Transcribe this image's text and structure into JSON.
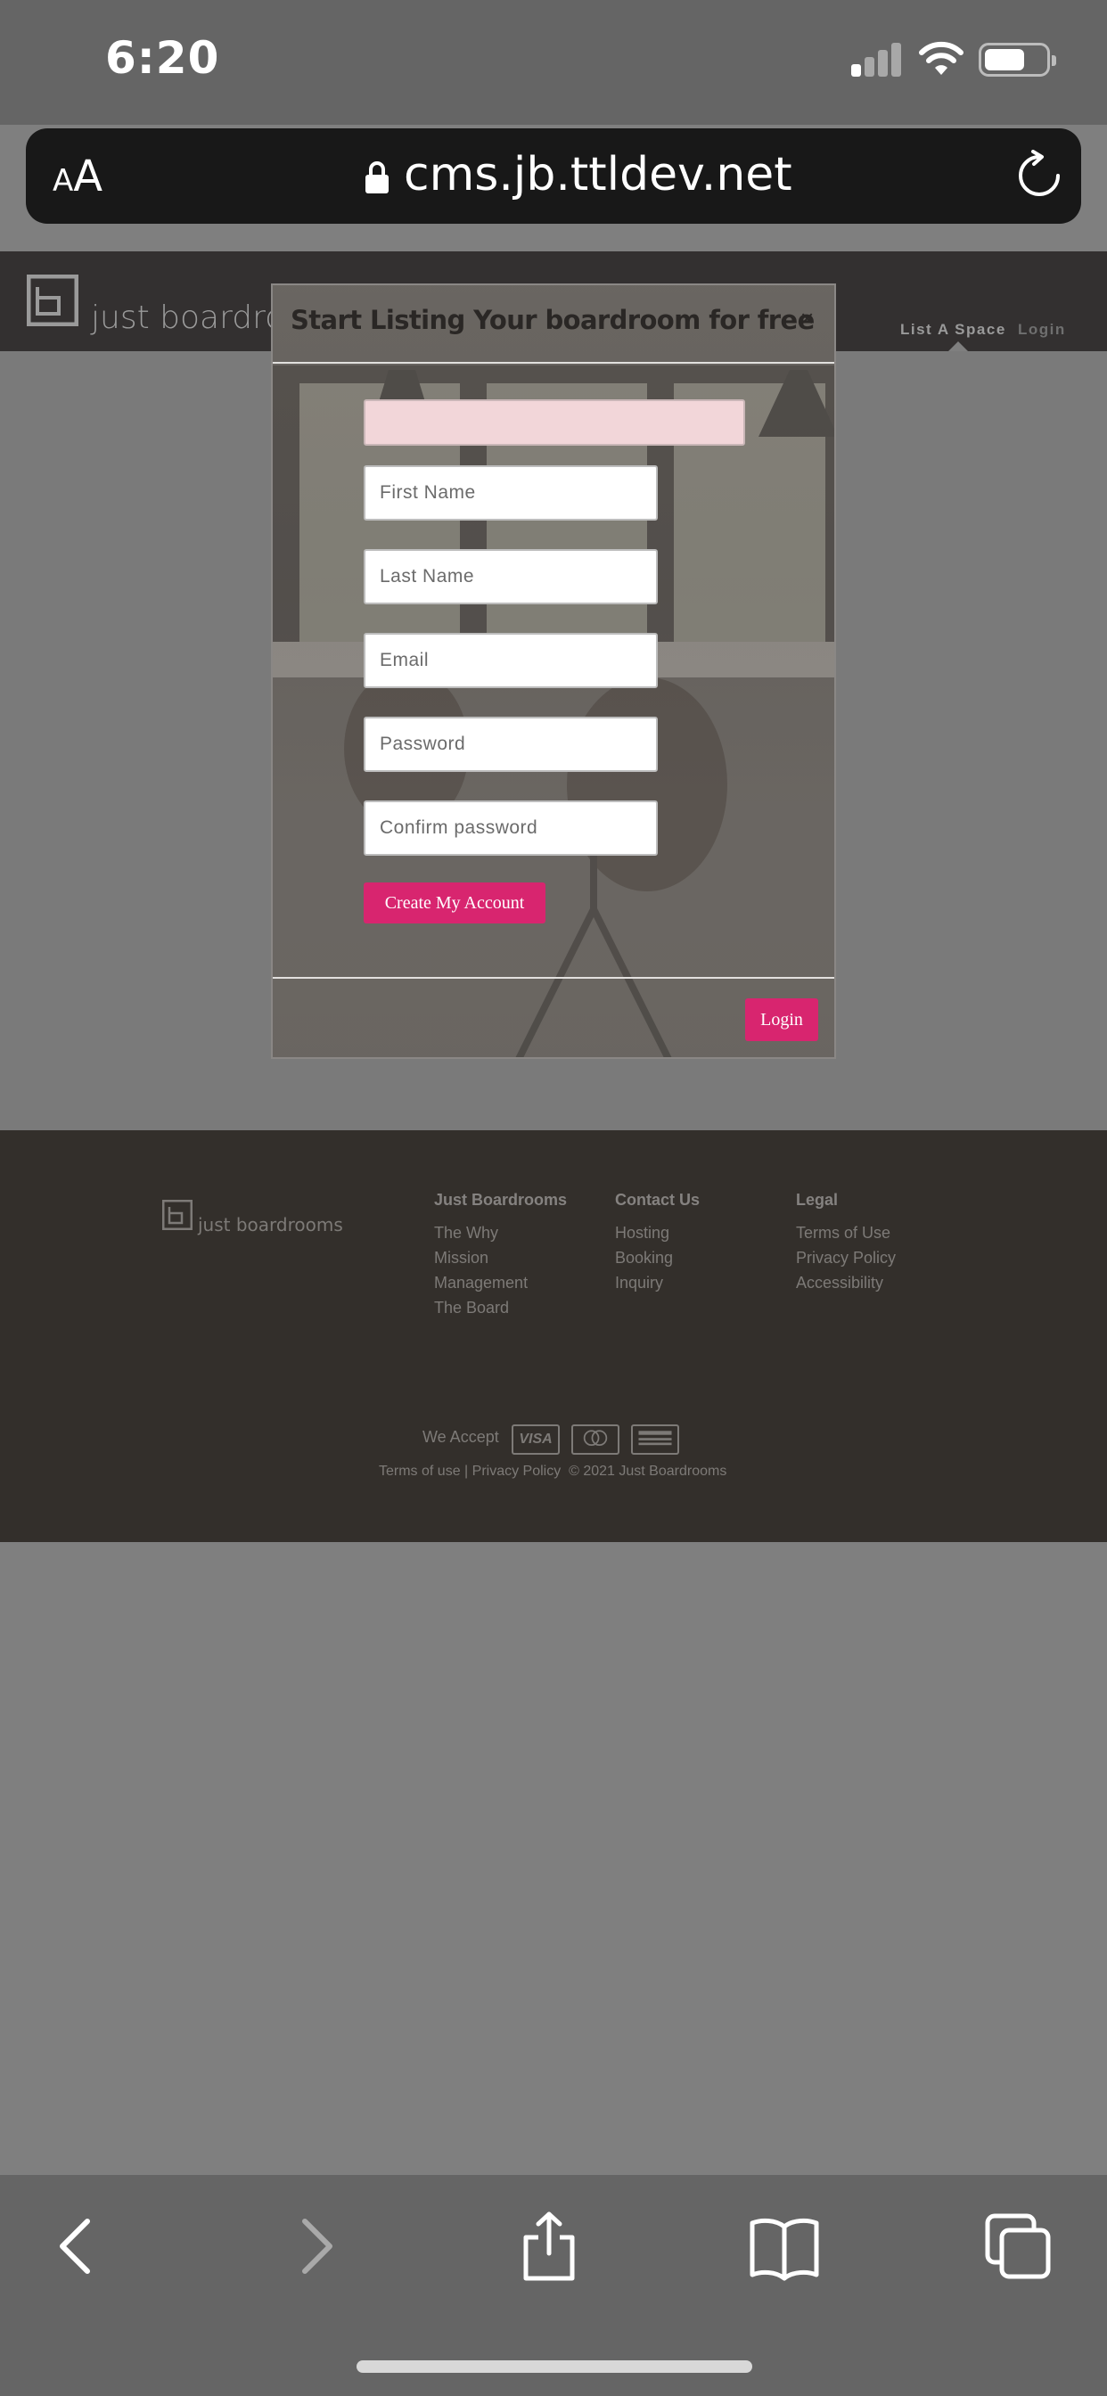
{
  "status_bar": {
    "time": "6:20"
  },
  "browser": {
    "text_size_label_small": "A",
    "text_size_label_big": "A",
    "url": "cms.jb.ttldev.net"
  },
  "site": {
    "logo_text": "just boardrooms",
    "nav": {
      "list_space": "List A Space",
      "login": "Login"
    }
  },
  "modal": {
    "title": "Start Listing Your boardroom for free",
    "close_label": "×",
    "fields": {
      "first_name": "First Name",
      "last_name": "Last Name",
      "email": "Email",
      "password": "Password",
      "confirm_password": "Confirm password"
    },
    "create_button": "Create My Account",
    "login_button": "Login"
  },
  "footer": {
    "logo_text": "just boardrooms",
    "columns": [
      {
        "heading": "Just Boardrooms",
        "links": [
          "The Why",
          "Mission",
          "Management",
          "The Board"
        ]
      },
      {
        "heading": "Contact Us",
        "links": [
          "Hosting",
          "Booking",
          "Inquiry"
        ]
      },
      {
        "heading": "Legal",
        "links": [
          "Terms of Use",
          "Privacy Policy",
          "Accessibility"
        ]
      }
    ],
    "we_accept": "We Accept",
    "cards": [
      "VISA",
      "mastercard",
      "amex"
    ],
    "visa_text": "VISA",
    "terms_link": "Terms of use",
    "privacy_link": "Privacy Policy",
    "copyright": "© 2021 Just Boardrooms"
  },
  "colors": {
    "accent": "#d8256f",
    "header_bg": "#333030",
    "footer_bg": "#332f2b"
  }
}
